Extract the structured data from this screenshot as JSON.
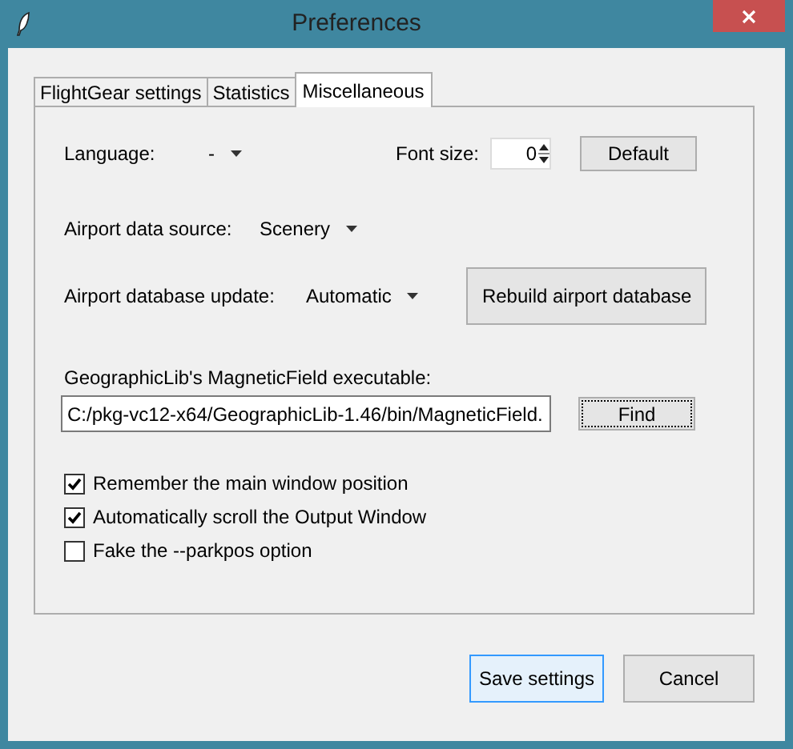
{
  "window": {
    "title": "Preferences"
  },
  "tabs": [
    {
      "label": "FlightGear settings",
      "selected": false
    },
    {
      "label": "Statistics",
      "selected": false
    },
    {
      "label": "Miscellaneous",
      "selected": true
    }
  ],
  "language": {
    "label": "Language:",
    "value": "-"
  },
  "font_size": {
    "label": "Font size:",
    "value": "0"
  },
  "default_button": "Default",
  "airport_data_source": {
    "label": "Airport data source:",
    "value": "Scenery"
  },
  "airport_database_update": {
    "label": "Airport database update:",
    "value": "Automatic"
  },
  "rebuild_button": "Rebuild airport database",
  "magnetic_field": {
    "label": "GeographicLib's MagneticField executable:",
    "value": "C:/pkg-vc12-x64/GeographicLib-1.46/bin/MagneticField."
  },
  "find_button": {
    "label": "Find",
    "focused": true
  },
  "options": [
    {
      "label": "Remember the main window position",
      "checked": true
    },
    {
      "label": "Automatically scroll the Output Window",
      "checked": true
    },
    {
      "label": "Fake the --parkpos option",
      "checked": false
    }
  ],
  "buttons": [
    {
      "label": "Save settings",
      "default": true
    },
    {
      "label": "Cancel",
      "default": false
    }
  ]
}
